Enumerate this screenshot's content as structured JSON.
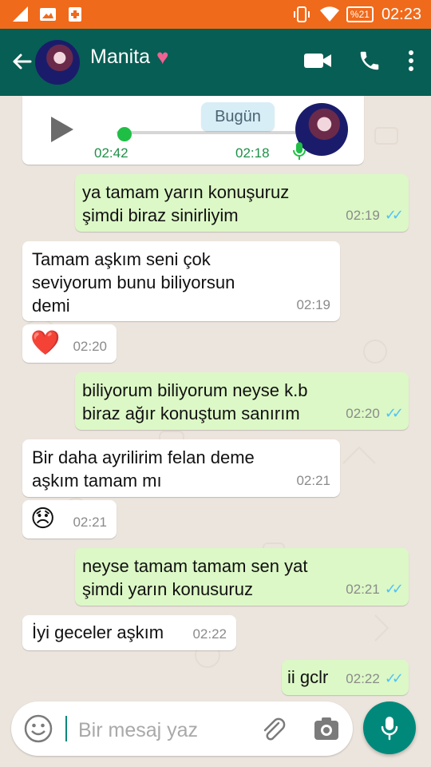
{
  "status_bar": {
    "battery": "%21",
    "time": "02:23"
  },
  "header": {
    "contact_name": "Manita",
    "heart": "♥"
  },
  "chat": {
    "voice_note": {
      "elapsed": "02:42",
      "sent_time": "02:18",
      "date_pill": "Bugün"
    },
    "messages": [
      {
        "text": "ya tamam yarın konuşuruz\nşimdi biraz sinirliyim",
        "time": "02:19"
      },
      {
        "text": "Tamam aşkım seni çok\nseviyorum bunu biliyorsun\ndemi",
        "time": "02:19"
      },
      {
        "text": "❤️",
        "time": "02:20"
      },
      {
        "text": "biliyorum biliyorum neyse k.b\nbiraz ağır konuştum sanırım",
        "time": "02:20"
      },
      {
        "text": "Bir daha ayrilirim felan deme\naşkım tamam mı",
        "time": "02:21"
      },
      {
        "text": "😞",
        "time": "02:21"
      },
      {
        "text": "neyse tamam tamam sen yat\nşimdi yarın konusuruz",
        "time": "02:21"
      },
      {
        "text": "İyi geceler aşkım",
        "time": "02:22"
      },
      {
        "text": "ii gclr",
        "time": "02:22"
      }
    ]
  },
  "composer": {
    "placeholder": "Bir mesaj yaz"
  },
  "colors": {
    "status_bar": "#f06a1b",
    "app_bar": "#075e54",
    "chat_bg": "#ece5dd",
    "incoming_bubble": "#ffffff",
    "outgoing_bubble": "#dcf8c6",
    "fab": "#00897b",
    "read_ticks": "#4fc3f7"
  },
  "icons": {
    "status_left": [
      "signal-icon",
      "image-icon",
      "medical-icon"
    ],
    "status_right": [
      "vibrate-icon",
      "wifi-icon",
      "battery-icon"
    ],
    "app_bar": [
      "back-arrow-icon",
      "video-call-icon",
      "phone-icon",
      "more-vert-icon"
    ],
    "composer": [
      "emoji-icon",
      "attach-icon",
      "camera-icon",
      "mic-icon"
    ]
  }
}
